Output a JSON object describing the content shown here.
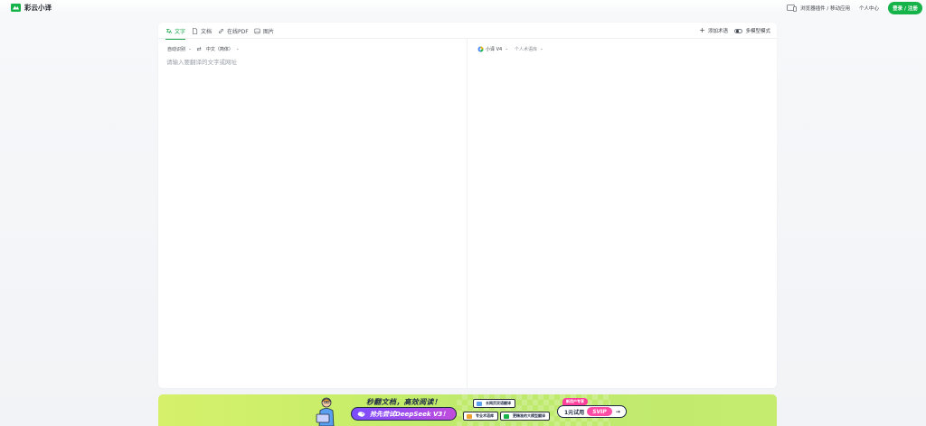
{
  "brand": {
    "name": "彩云小译",
    "color": "#16b34a"
  },
  "header": {
    "extension_link": "浏览器插件 / 移动应用",
    "account_link": "个人中心",
    "login_button": "登录 / 注册"
  },
  "tabs": [
    {
      "label": "文字",
      "icon": "text-translate-icon",
      "active": true
    },
    {
      "label": "文档",
      "icon": "document-icon",
      "active": false
    },
    {
      "label": "在线PDF",
      "icon": "link-icon",
      "active": false
    },
    {
      "label": "图片",
      "icon": "image-icon",
      "active": false
    }
  ],
  "toolbar": {
    "add_term": "添加术语",
    "multi_model": "多模型模式"
  },
  "source": {
    "language": "自动识别",
    "target_language": "中文（简体）",
    "placeholder": "请输入要翻译的文字或网址"
  },
  "target": {
    "engine": "小译 V4",
    "term_library": "个人术语库"
  },
  "promo": {
    "title": "秒翻文档，高效阅读！",
    "highlight": "抢先尝试DeepSeek V3！",
    "features": [
      "长网页双语翻译",
      "专业术语库",
      "更精准的大模型翻译"
    ],
    "new_user_badge": "新用户专享",
    "cta_prefix": "1元试用",
    "cta_highlight": "SVIP"
  },
  "colors": {
    "accent": "#16a34a",
    "promo_pink": "#ff4da6",
    "promo_purple": "#7b4dff",
    "promo_lime": "#c8ee6a"
  }
}
